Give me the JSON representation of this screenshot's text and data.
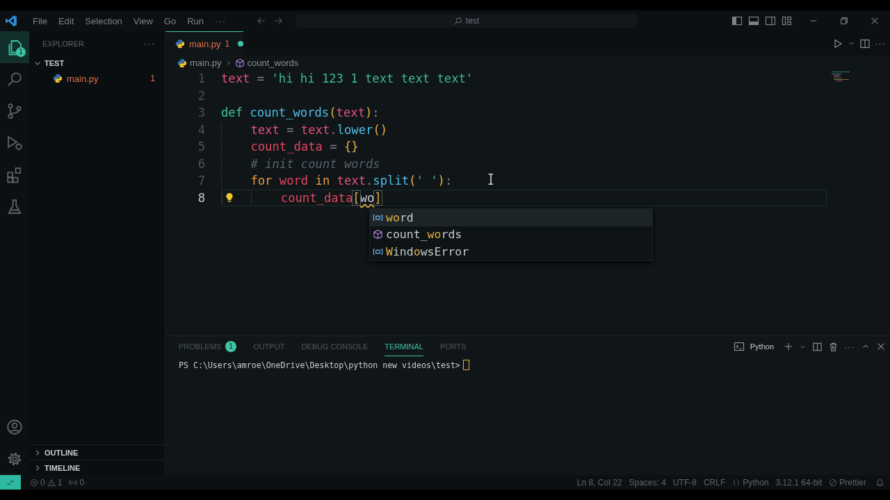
{
  "title_bar": {
    "menu": [
      "File",
      "Edit",
      "Selection",
      "View",
      "Go",
      "Run"
    ],
    "overflow": "···",
    "search": "test"
  },
  "activity_bar": {
    "items": [
      {
        "kind": "explorer",
        "selected": true,
        "badge": "1"
      },
      {
        "kind": "search",
        "selected": false
      },
      {
        "kind": "source_control",
        "selected": false
      },
      {
        "kind": "debug",
        "selected": false
      },
      {
        "kind": "extensions",
        "selected": false
      },
      {
        "kind": "testing",
        "selected": false
      }
    ],
    "bottom": [
      {
        "kind": "accounts"
      },
      {
        "kind": "settings"
      }
    ]
  },
  "sidebar": {
    "title": "EXPLORER",
    "more": "···",
    "folder": {
      "name": "TEST",
      "expanded": true,
      "children": [
        {
          "name": "main.py",
          "problems": "1"
        }
      ]
    },
    "sections": [
      {
        "name": "OUTLINE",
        "expanded": false
      },
      {
        "name": "TIMELINE",
        "expanded": false
      }
    ]
  },
  "editor": {
    "tabs": [
      {
        "name": "main.py",
        "problems": "1",
        "modified": true,
        "selected": true
      }
    ],
    "more": "···",
    "breadcrumbs": [
      {
        "kind": "file",
        "text": "main.py"
      },
      {
        "kind": "symbol",
        "text": "count_words"
      }
    ],
    "lines": [
      {
        "number": "1",
        "current": false,
        "lightbulb": false,
        "tokens": [
          {
            "kind": "var",
            "text": "text"
          },
          {
            "kind": "op",
            "text": " = "
          },
          {
            "kind": "string",
            "text": "'hi hi 123 1 text text text'"
          }
        ]
      },
      {
        "number": "2",
        "current": false,
        "lightbulb": false
      },
      {
        "number": "3",
        "current": false,
        "lightbulb": false,
        "tokens": [
          {
            "kind": "keyword",
            "text": "def"
          },
          {
            "kind": "func",
            "text": " count_words"
          },
          {
            "kind": "paren",
            "text": "("
          },
          {
            "kind": "var",
            "text": "text"
          },
          {
            "kind": "paren",
            "text": ")"
          },
          {
            "kind": "op",
            "text": ":"
          }
        ]
      },
      {
        "number": "4",
        "current": false,
        "lightbulb": false,
        "tokens": [
          {
            "kind": "var",
            "text": "    text"
          },
          {
            "kind": "op",
            "text": " = "
          },
          {
            "kind": "var",
            "text": "text"
          },
          {
            "kind": "op",
            "text": "."
          },
          {
            "kind": "func",
            "text": "lower"
          },
          {
            "kind": "paren",
            "text": "()"
          }
        ]
      },
      {
        "number": "5",
        "current": false,
        "lightbulb": false,
        "tokens": [
          {
            "kind": "var2",
            "text": "    count_data"
          },
          {
            "kind": "op",
            "text": " = "
          },
          {
            "kind": "paren",
            "text": "{}"
          }
        ]
      },
      {
        "number": "6",
        "current": false,
        "lightbulb": false,
        "tokens": [
          {
            "kind": "comment",
            "text": "    # init count words"
          }
        ]
      },
      {
        "number": "7",
        "current": false,
        "lightbulb": false,
        "tokens": [
          {
            "kind": "control",
            "text": "    for"
          },
          {
            "kind": "var2",
            "text": " word"
          },
          {
            "kind": "control",
            "text": " in"
          },
          {
            "kind": "var",
            "text": " text"
          },
          {
            "kind": "op",
            "text": "."
          },
          {
            "kind": "func",
            "text": "split"
          },
          {
            "kind": "paren",
            "text": "("
          },
          {
            "kind": "string",
            "text": "' '"
          },
          {
            "kind": "paren",
            "text": ")"
          },
          {
            "kind": "op",
            "text": ":"
          }
        ]
      },
      {
        "number": "8",
        "current": true,
        "lightbulb": true,
        "tokens": [
          {
            "kind": "var2",
            "text": "        count_data"
          },
          {
            "kind": "bracket",
            "text": "["
          },
          {
            "kind": "typed",
            "text": "wo"
          },
          {
            "kind": "bracket",
            "text": "]"
          }
        ]
      }
    ],
    "suggestions": [
      {
        "kind": "variable",
        "selected": true,
        "label": "**wo**rd"
      },
      {
        "kind": "function",
        "selected": false,
        "label": "count_**wo**rds"
      },
      {
        "kind": "variable",
        "selected": false,
        "label": "**W**ind**o**wsError"
      }
    ]
  },
  "panel": {
    "tabs": [
      {
        "label": "PROBLEMS",
        "badge": "1",
        "selected": false
      },
      {
        "label": "OUTPUT",
        "selected": false
      },
      {
        "label": "DEBUG CONSOLE",
        "selected": false
      },
      {
        "label": "TERMINAL",
        "selected": true
      },
      {
        "label": "PORTS",
        "selected": false
      }
    ],
    "terminal_name": "Python",
    "more": "···",
    "prompt": "PS C:\\Users\\amroe\\OneDrive\\Desktop\\python new videos\\test>"
  },
  "status_bar": {
    "errors": "0",
    "warnings": "1",
    "ports": "0",
    "items": [
      {
        "kind": "text",
        "text": "Ln 8, Col 22"
      },
      {
        "kind": "text",
        "text": "Spaces: 4"
      },
      {
        "kind": "text",
        "text": "UTF-8"
      },
      {
        "kind": "text",
        "text": "CRLF"
      },
      {
        "kind": "language",
        "text": "Python"
      },
      {
        "kind": "text",
        "text": "3.12.1 64-bit"
      },
      {
        "kind": "formatter",
        "text": "Prettier"
      }
    ]
  }
}
